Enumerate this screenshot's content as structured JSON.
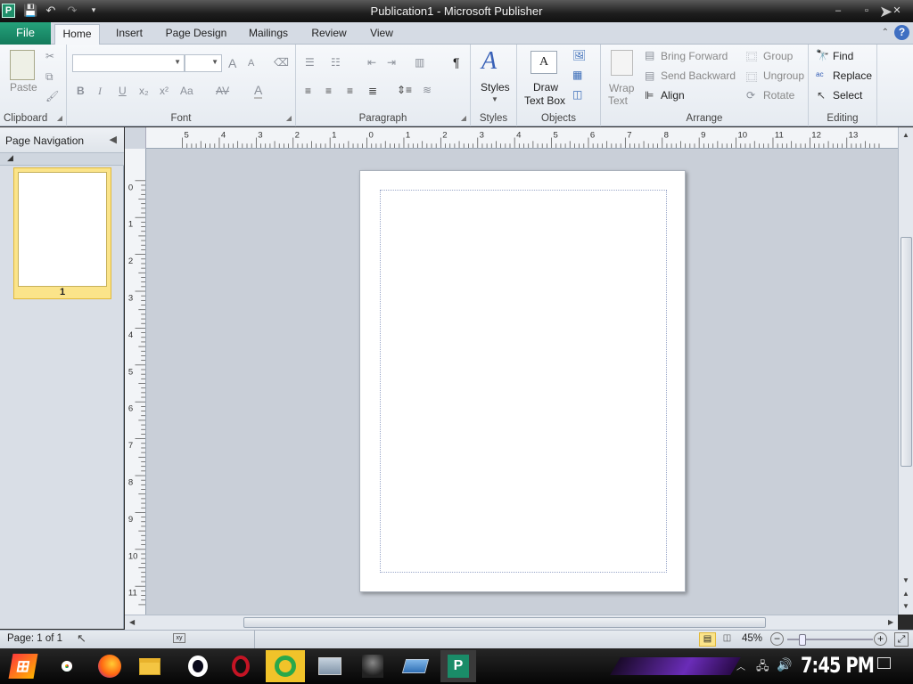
{
  "window": {
    "title": "Publication1 - Microsoft Publisher",
    "app_icon_letter": "P"
  },
  "tabs": {
    "file": "File",
    "items": [
      "Home",
      "Insert",
      "Page Design",
      "Mailings",
      "Review",
      "View"
    ],
    "active": "Home"
  },
  "ribbon": {
    "clipboard": {
      "label": "Clipboard",
      "paste": "Paste"
    },
    "font": {
      "label": "Font",
      "bold": "B",
      "italic": "I",
      "underline": "U",
      "sub": "x₂",
      "sup": "x²",
      "change_case": "Aa",
      "grow": "A",
      "shrink": "A",
      "font_color": "A",
      "spacing": "AV"
    },
    "paragraph": {
      "label": "Paragraph",
      "pilcrow": "¶"
    },
    "styles": {
      "label": "Styles",
      "button": "Styles"
    },
    "objects": {
      "label": "Objects",
      "draw_text_box_line1": "Draw",
      "draw_text_box_line2": "Text Box"
    },
    "arrange": {
      "label": "Arrange",
      "wrap_line1": "Wrap",
      "wrap_line2": "Text",
      "bring_forward": "Bring Forward",
      "send_backward": "Send Backward",
      "align": "Align",
      "group": "Group",
      "ungroup": "Ungroup",
      "rotate": "Rotate"
    },
    "editing": {
      "label": "Editing",
      "find": "Find",
      "replace": "Replace",
      "select": "Select"
    }
  },
  "navigation": {
    "title": "Page Navigation",
    "thumbnails": [
      {
        "page": "1",
        "selected": true
      }
    ]
  },
  "ruler": {
    "horizontal": [
      "5",
      "4",
      "3",
      "2",
      "1",
      "0",
      "1",
      "2",
      "3",
      "4",
      "5",
      "6",
      "7",
      "8",
      "9",
      "10",
      "11",
      "12",
      "13"
    ],
    "vertical": [
      "0",
      "1",
      "2",
      "3",
      "4",
      "5",
      "6",
      "7",
      "8",
      "9",
      "10",
      "11"
    ]
  },
  "status": {
    "page": "Page: 1 of 1",
    "zoom": "45%"
  },
  "taskbar": {
    "clock": "7:45 PM",
    "apps": [
      "start-button",
      "chrome-icon",
      "firefox-icon",
      "file-explorer-icon",
      "opera-icon",
      "opera-gx-icon",
      "opera-neon-icon",
      "photos-icon",
      "media-icon",
      "virtual-desktop-icon",
      "publisher-icon"
    ]
  },
  "colors": {
    "file_tab": "#1a8c68",
    "selected_thumb": "#fbe48a",
    "canvas": "#c9cfd8",
    "taskbar_accent": "#6a2cb8"
  }
}
